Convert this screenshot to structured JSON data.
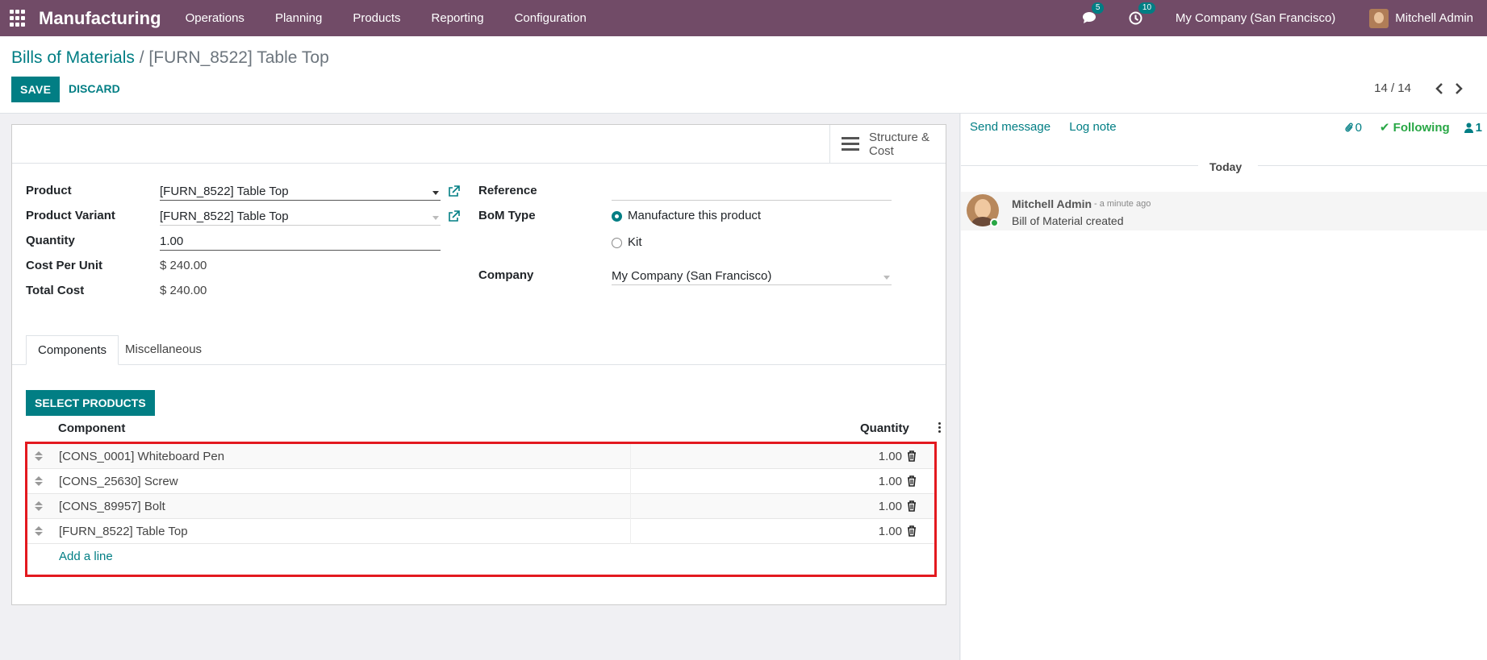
{
  "navbar": {
    "brand": "Manufacturing",
    "menu": [
      "Operations",
      "Planning",
      "Products",
      "Reporting",
      "Configuration"
    ],
    "messages_count": "5",
    "activities_count": "10",
    "company": "My Company (San Francisco)",
    "user": "Mitchell Admin"
  },
  "control": {
    "breadcrumb_parent": "Bills of Materials",
    "breadcrumb_sep": " / ",
    "breadcrumb_current": "[FURN_8522] Table Top",
    "save_label": "SAVE",
    "discard_label": "DISCARD",
    "pager": "14 / 14"
  },
  "form": {
    "structure_button": [
      "Structure &",
      "Cost"
    ],
    "product_label": "Product",
    "product_value": "[FURN_8522] Table Top",
    "variant_label": "Product Variant",
    "variant_value": "[FURN_8522] Table Top",
    "quantity_label": "Quantity",
    "quantity_value": "1.00",
    "cost_unit_label": "Cost Per Unit",
    "cost_unit_value": "$ 240.00",
    "total_cost_label": "Total Cost",
    "total_cost_value": "$ 240.00",
    "reference_label": "Reference",
    "reference_value": "",
    "bom_type_label": "BoM Type",
    "bom_type_options": [
      "Manufacture this product",
      "Kit"
    ],
    "bom_type_selected": "Manufacture this product",
    "company_label": "Company",
    "company_value": "My Company (San Francisco)"
  },
  "tabs": [
    "Components",
    "Miscellaneous"
  ],
  "components": {
    "select_products_label": "SELECT PRODUCTS",
    "headers": [
      "Component",
      "Quantity"
    ],
    "rows": [
      {
        "name": "[CONS_0001] Whiteboard Pen",
        "qty": "1.00"
      },
      {
        "name": "[CONS_25630] Screw",
        "qty": "1.00"
      },
      {
        "name": "[CONS_89957] Bolt",
        "qty": "1.00"
      },
      {
        "name": "[FURN_8522] Table Top",
        "qty": "1.00"
      }
    ],
    "add_line": "Add a line"
  },
  "chatter": {
    "send_message": "Send message",
    "log_note": "Log note",
    "attachments": "0",
    "following": "Following",
    "followers": "1",
    "date_separator": "Today",
    "message_author": "Mitchell Admin",
    "message_time": "- a minute ago",
    "message_body": "Bill of Material created"
  },
  "colors": {
    "navbar": "#714b67",
    "primary": "#017e84",
    "highlight_border": "#e3191f",
    "following": "#28a745"
  }
}
